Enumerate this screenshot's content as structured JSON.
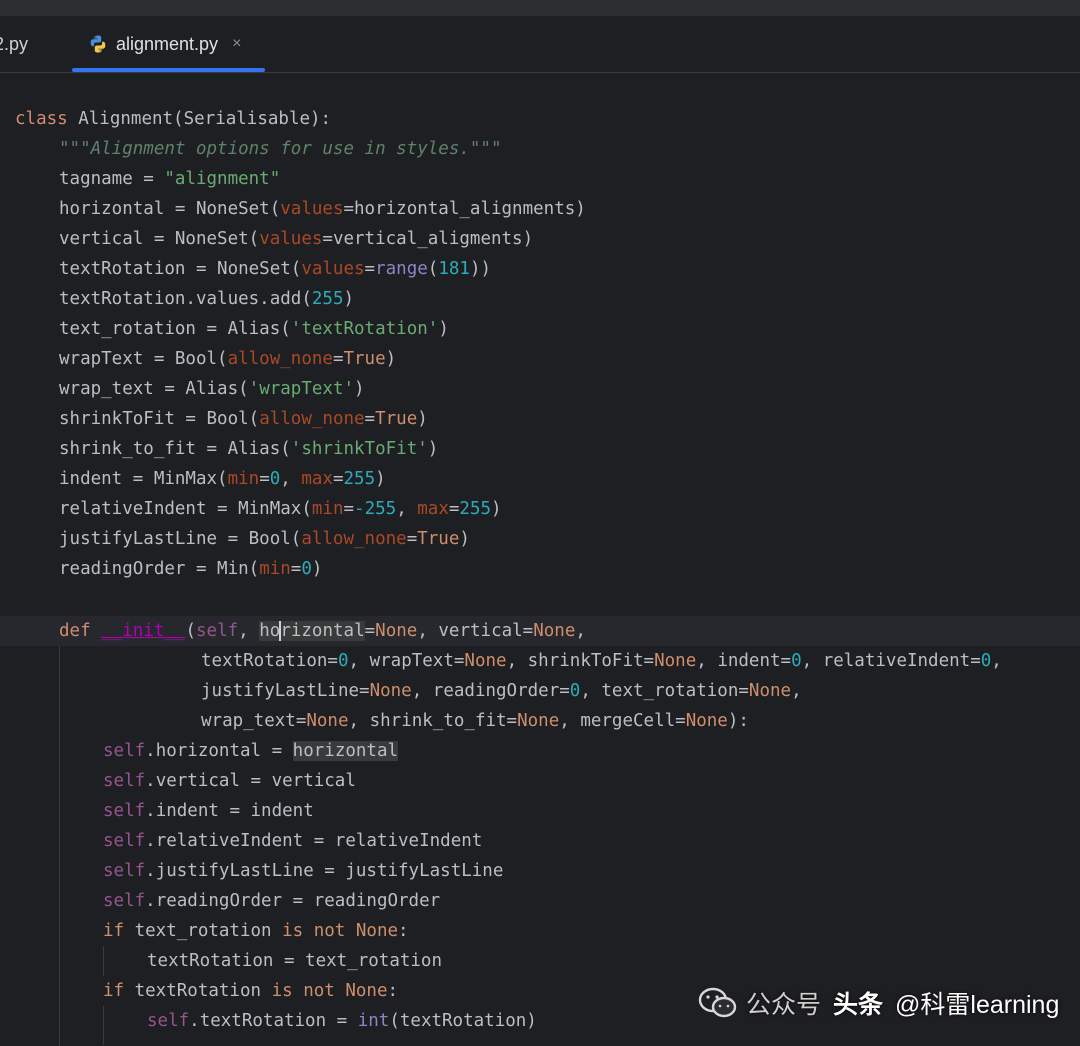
{
  "tabs": {
    "previous_tab": "2.py",
    "active_tab": "alignment.py",
    "close_symbol": "×"
  },
  "watermark": {
    "platform_left": "公众号",
    "platform_right": "头条",
    "handle": "@科雷learning"
  },
  "code": {
    "l01_class_kw": "class",
    "l01_rest": " Alignment(Serialisable):",
    "l02_doc": "\"\"\"Alignment options for use in styles.\"\"\"",
    "l03_a": "tagname = ",
    "l03_str": "\"alignment\"",
    "l04_a": "horizontal = NoneSet(",
    "l04_p": "values",
    "l04_b": "=horizontal_alignments)",
    "l05_a": "vertical = NoneSet(",
    "l05_p": "values",
    "l05_b": "=vertical_aligments)",
    "l06_a": "textRotation = NoneSet(",
    "l06_p": "values",
    "l06_eq": "=",
    "l06_builtin": "range",
    "l06_open": "(",
    "l06_num": "181",
    "l06_close": "))",
    "l07_a": "textRotation.values.add(",
    "l07_num": "255",
    "l07_b": ")",
    "l08_a": "text_rotation = Alias(",
    "l08_str": "'textRotation'",
    "l08_b": ")",
    "l09_a": "wrapText = Bool(",
    "l09_p": "allow_none",
    "l09_eq": "=",
    "l09_kw": "True",
    "l09_b": ")",
    "l10_a": "wrap_text = Alias(",
    "l10_str": "'wrapText'",
    "l10_b": ")",
    "l11_a": "shrinkToFit = Bool(",
    "l11_p": "allow_none",
    "l11_eq": "=",
    "l11_kw": "True",
    "l11_b": ")",
    "l12_a": "shrink_to_fit = Alias(",
    "l12_str": "'shrinkToFit'",
    "l12_b": ")",
    "l13_a": "indent = MinMax(",
    "l13_p1": "min",
    "l13_eq1": "=",
    "l13_n1": "0",
    "l13_sep": ", ",
    "l13_p2": "max",
    "l13_eq2": "=",
    "l13_n2": "255",
    "l13_b": ")",
    "l14_a": "relativeIndent = MinMax(",
    "l14_p1": "min",
    "l14_eq1": "=",
    "l14_n1": "-255",
    "l14_sep": ", ",
    "l14_p2": "max",
    "l14_eq2": "=",
    "l14_n2": "255",
    "l14_b": ")",
    "l15_a": "justifyLastLine = Bool(",
    "l15_p": "allow_none",
    "l15_eq": "=",
    "l15_kw": "True",
    "l15_b": ")",
    "l16_a": "readingOrder = Min(",
    "l16_p": "min",
    "l16_eq": "=",
    "l16_n": "0",
    "l16_b": ")",
    "l17_def": "def",
    "l17_sp": " ",
    "l17_init": "__init__",
    "l17_open": "(",
    "l17_self": "self",
    "l17_comma": ", ",
    "l17_hl_a": "ho",
    "l17_hl_b": "rizontal",
    "l17_eq": "=",
    "l17_none1": "None",
    "l17_mid": ", vertical=",
    "l17_none2": "None",
    "l17_end": ",",
    "l18_a": "textRotation=",
    "l18_n1": "0",
    "l18_b": ", wrapText=",
    "l18_k1": "None",
    "l18_c": ", shrinkToFit=",
    "l18_k2": "None",
    "l18_d": ", indent=",
    "l18_n2": "0",
    "l18_e": ", relativeIndent=",
    "l18_n3": "0",
    "l18_f": ",",
    "l19_a": "justifyLastLine=",
    "l19_k1": "None",
    "l19_b": ", readingOrder=",
    "l19_n1": "0",
    "l19_c": ", text_rotation=",
    "l19_k2": "None",
    "l19_d": ",",
    "l20_a": "wrap_text=",
    "l20_k1": "None",
    "l20_b": ", shrink_to_fit=",
    "l20_k2": "None",
    "l20_c": ", mergeCell=",
    "l20_k3": "None",
    "l20_d": "):",
    "self": "self",
    "l21_a": ".horizontal = ",
    "l21_hl": "horizontal",
    "l22_a": ".vertical = vertical",
    "l23_a": ".indent = indent",
    "l24_a": ".relativeIndent = relativeIndent",
    "l25_a": ".justifyLastLine = justifyLastLine",
    "l26_a": ".readingOrder = readingOrder",
    "l27_if": "if",
    "l27_a": " text_rotation ",
    "l27_is": "is not",
    "l27_sp": " ",
    "l27_none": "None",
    "l27_colon": ":",
    "l28_a": "textRotation = text_rotation",
    "l29_if": "if",
    "l29_a": " textRotation ",
    "l29_is": "is not",
    "l29_sp": " ",
    "l29_none": "None",
    "l29_colon": ":",
    "l30_a": ".textRotation = ",
    "l30_builtin": "int",
    "l30_b": "(textRotation)"
  }
}
